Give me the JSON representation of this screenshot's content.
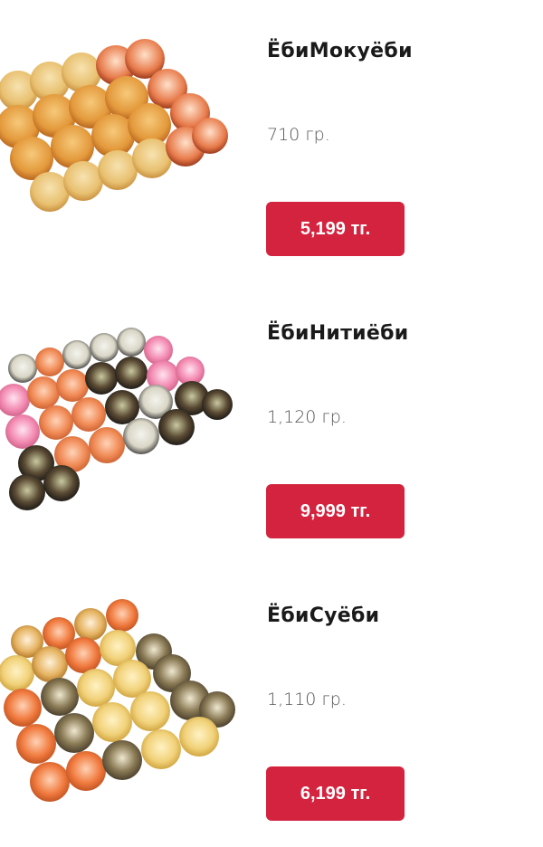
{
  "products": [
    {
      "title": "ЁбиМокуёби",
      "weight": "710 гр.",
      "price": "5,199 тг.",
      "image_icon": "sushi-set-baked-rolls-image"
    },
    {
      "title": "ЁбиНитиёби",
      "weight": "1,120 гр.",
      "price": "9,999 тг.",
      "image_icon": "sushi-set-mixed-rolls-image"
    },
    {
      "title": "ЁбиСуёби",
      "weight": "1,110 гр.",
      "price": "6,199 тг.",
      "image_icon": "sushi-set-assorted-rolls-image"
    }
  ],
  "colors": {
    "price_button_bg": "#d4233f",
    "price_button_text": "#ffffff"
  }
}
